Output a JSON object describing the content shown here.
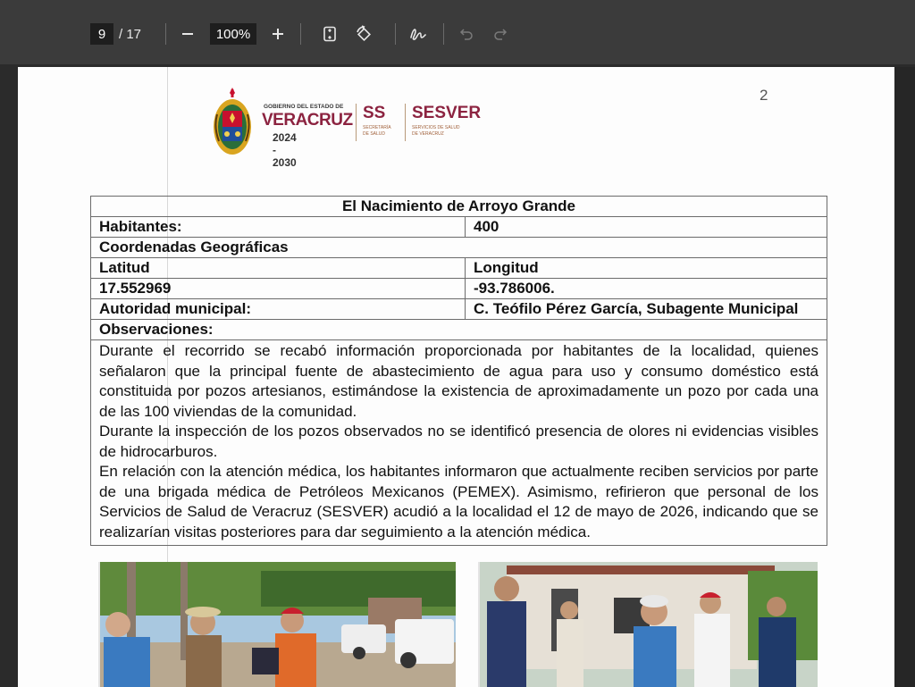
{
  "viewer": {
    "current_page": "9",
    "total_pages": "/ 17",
    "zoom": "100%",
    "icons": {
      "zoom_out": "minus-icon",
      "zoom_in": "plus-icon",
      "fit_page": "fit-page-icon",
      "rotate": "rotate-icon",
      "draw": "draw-icon",
      "undo": "undo-icon",
      "redo": "redo-icon"
    }
  },
  "document": {
    "page_number": "2",
    "header": {
      "gov_line": "GOBIERNO DEL ESTADO DE",
      "state": "VERACRUZ",
      "years": "2024 - 2030",
      "ss": "SS",
      "ss_sub": "SECRETARÍA DE SALUD",
      "sesver": "SESVER",
      "sesver_sub": "SERVICIOS DE SALUD DE VERACRUZ"
    },
    "table": {
      "title": "El Nacimiento de Arroyo Grande",
      "habitantes_label": "Habitantes:",
      "habitantes_value": "400",
      "coords_label": "Coordenadas Geográficas",
      "lat_label": "Latitud",
      "lon_label": "Longitud",
      "lat_value": "17.552969",
      "lon_value": "-93.786006.",
      "autoridad_label": "Autoridad municipal:",
      "autoridad_value": "C. Teófilo Pérez García, Subagente Municipal",
      "obs_label": "Observaciones:",
      "obs_p1": "Durante el recorrido se recabó información proporcionada por habitantes de la localidad, quienes señalaron que la principal fuente de abastecimiento de agua para uso y consumo doméstico está constituida por pozos artesianos, estimándose la existencia de aproximadamente un pozo por cada una de las 100 viviendas de la comunidad.",
      "obs_p2": "Durante la inspección de los pozos observados no se identificó presencia de olores ni evidencias visibles de hidrocarburos.",
      "obs_p3": "En relación con la atención médica, los habitantes informaron que actualmente reciben servicios por parte de una brigada médica de Petróleos Mexicanos (PEMEX). Asimismo, refirieron que personal de los Servicios de Salud de Veracruz (SESVER) acudió a la localidad el 12 de mayo de 2026, indicando que se realizarían visitas posteriores para dar seguimiento a la atención médica."
    }
  },
  "colors": {
    "toolbar_bg": "#3b3b3b",
    "viewer_bg": "#2b2b2b",
    "brand": "#8c2340"
  }
}
